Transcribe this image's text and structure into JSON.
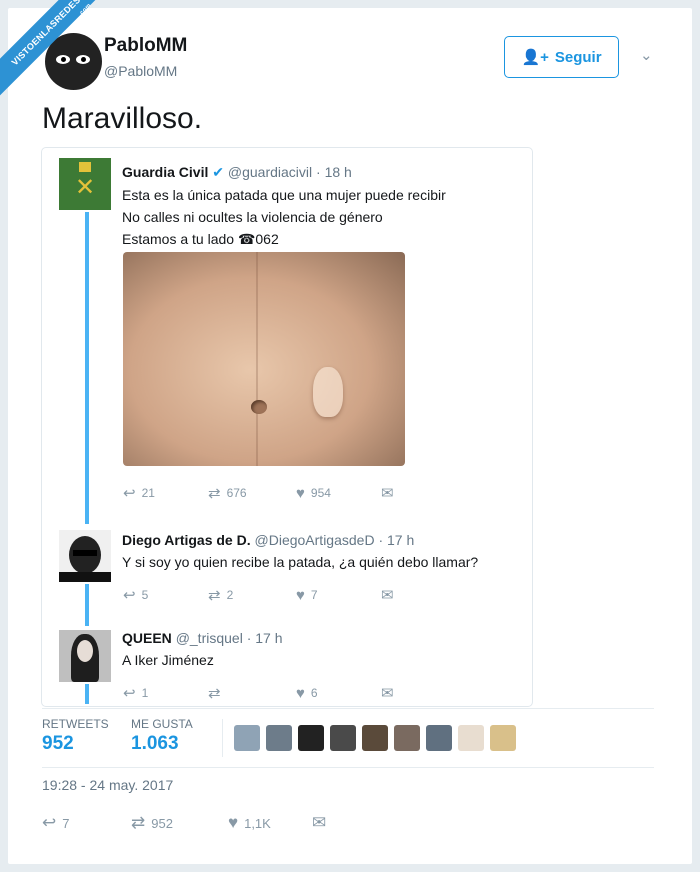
{
  "watermark": {
    "line1": "VISTOENLASREDES",
    "line2": ".com"
  },
  "author": {
    "name": "PabloMM",
    "handle": "@PabloMM"
  },
  "follow_label": "Seguir",
  "tweet_text": "Maravilloso.",
  "quoted": {
    "name": "Guardia Civil",
    "handle": "@guardiacivil",
    "time": "· 18 h",
    "lines": [
      "Esta es la única patada que una mujer puede recibir",
      "No calles ni ocultes la violencia de género",
      "Estamos a tu lado ☎062"
    ],
    "replies": "21",
    "retweets": "676",
    "likes": "954"
  },
  "replies": [
    {
      "name": "Diego Artigas de D.",
      "handle": "@DiegoArtigasdeD",
      "time": "· 17 h",
      "text": "Y si soy yo quien recibe la patada, ¿a quién debo llamar?",
      "replies": "5",
      "retweets": "2",
      "likes": "7"
    },
    {
      "name": "QUEEN",
      "handle": "@_trisquel",
      "time": "· 17 h",
      "text": "A Iker Jiménez",
      "replies": "1",
      "retweets": "",
      "likes": "6"
    }
  ],
  "stats": {
    "retweets_label": "RETWEETS",
    "retweets": "952",
    "likes_label": "ME GUSTA",
    "likes": "1.063"
  },
  "date": "19:28 - 24 may. 2017",
  "bottom": {
    "replies": "7",
    "retweets": "952",
    "likes": "1,1K"
  },
  "colors": {
    "accent": "#1b95e0",
    "thread": "#4ab3f4",
    "muted": "#8899a6"
  }
}
